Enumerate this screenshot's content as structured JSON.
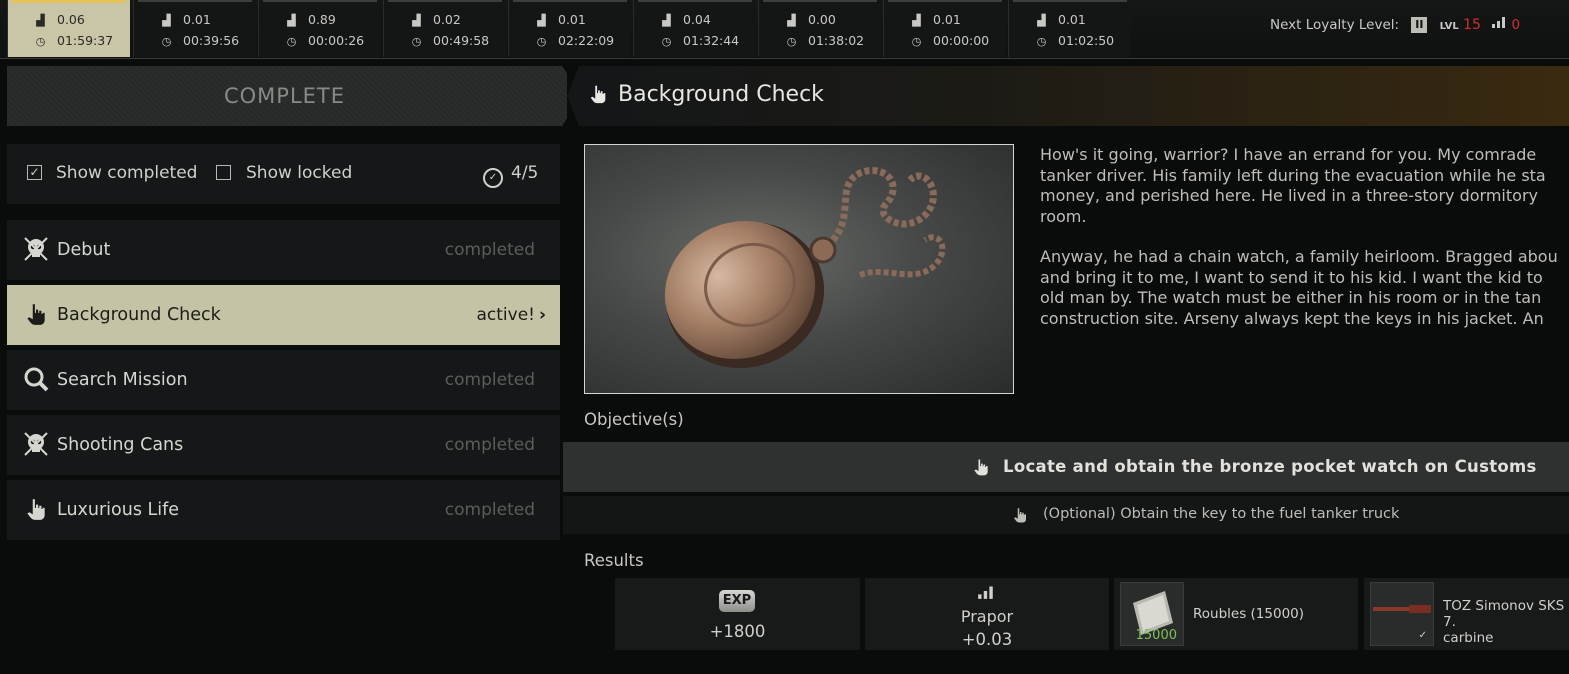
{
  "traders": [
    {
      "standing": "0.06",
      "time": "01:59:37",
      "selected": true
    },
    {
      "standing": "0.01",
      "time": "00:39:56"
    },
    {
      "standing": "0.89",
      "time": "00:00:26"
    },
    {
      "standing": "0.02",
      "time": "00:49:58"
    },
    {
      "standing": "0.01",
      "time": "02:22:09"
    },
    {
      "standing": "0.04",
      "time": "01:32:44"
    },
    {
      "standing": "0.00",
      "time": "01:38:02"
    },
    {
      "standing": "0.01",
      "time": "00:00:00"
    },
    {
      "standing": "0.01",
      "time": "01:02:50"
    }
  ],
  "loyalty": {
    "next_label": "Next Loyalty Level:",
    "roman": "II",
    "lvl_prefix": "LVL",
    "lvl_value": "15",
    "req_partial": "0"
  },
  "left": {
    "tab_label": "COMPLETE",
    "show_completed_label": "Show completed",
    "show_completed_checked": true,
    "show_locked_label": "Show locked",
    "show_locked_checked": false,
    "count": "4/5",
    "quests": [
      {
        "name": "Debut",
        "status": "completed",
        "icon": "skull-icon"
      },
      {
        "name": "Background Check",
        "status": "active!",
        "icon": "hand-pointer-icon",
        "active": true
      },
      {
        "name": "Search Mission",
        "status": "completed",
        "icon": "magnifier-icon"
      },
      {
        "name": "Shooting Cans",
        "status": "completed",
        "icon": "skull-icon"
      },
      {
        "name": "Luxurious Life",
        "status": "completed",
        "icon": "hand-pointer-icon"
      }
    ]
  },
  "quest": {
    "title": "Background Check",
    "description": [
      "How's it going, warrior? I have an errand for you. My comrade",
      "tanker driver. His family left during the evacuation while he sta",
      "money, and perished here. He lived in a three-story dormitory",
      "room."
    ],
    "description2": [
      "Anyway, he had a chain watch, a family heirloom. Bragged abou",
      "and bring it to me, I want to send it to his kid. I want the kid to",
      "old man by. The watch must be either in his room or in the tan",
      "construction site. Arseny always kept the keys in his jacket. An"
    ],
    "objectives_label": "Objective(s)",
    "objective_main": "Locate and obtain the bronze pocket watch on Customs",
    "objective_optional": "(Optional) Obtain the key to the fuel tanker truck",
    "results_label": "Results",
    "rewards": {
      "exp_badge": "EXP",
      "exp_value": "+1800",
      "trader_name": "Prapor",
      "trader_value": "+0.03",
      "roubles_label": "Roubles (15000)",
      "roubles_stack": "15000",
      "weapon_label_line1": "TOZ Simonov SKS 7.",
      "weapon_label_line2": "carbine"
    }
  },
  "colors": {
    "accent_gold": "#e3c35a",
    "active_row": "#c5c3a6",
    "status_red": "#d03030",
    "stack_green": "#7fc05a"
  }
}
